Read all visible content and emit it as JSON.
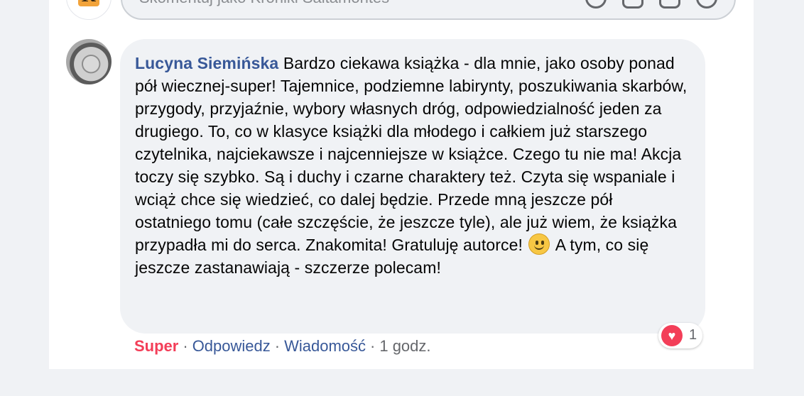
{
  "composer": {
    "placeholder": "Skomentuj jako Kroniki Saltamontes",
    "page_logo_letter": "K",
    "icons": [
      "emoji-icon",
      "camera-icon",
      "gif-icon",
      "sticker-icon"
    ]
  },
  "comment": {
    "author": "Lucyna Siemińska",
    "text_before_emoji": "Bardzo ciekawa książka - dla mnie, jako osoby ponad pół wiecznej-super! Tajemnice, podziemne labirynty, poszukiwania skarbów, przygody, przyjaźnie, wybory własnych dróg, odpowiedzialność jeden za drugiego. To, co w klasyce książki dla młodego i całkiem już starszego czytelnika, najciekawsze i najcenniejsze w książce. Czego tu nie ma! Akcja toczy się szybko. Są i duchy i czarne charaktery też. Czyta się wspaniale i wciąż chce się wiedzieć, co dalej będzie. Przede mną jeszcze pół ostatniego tomu (całe szczęście, że jeszcze tyle), ale już wiem, że książka przypadła mi do serca. Znakomita! Gratuluję autorce!",
    "emoji": "slightly-smiling-face-emoji",
    "text_after_emoji": "A tym, co się jeszcze zastanawiają - szczerze polecam!",
    "reaction": {
      "icon": "heart-icon",
      "count": "1"
    },
    "actions": {
      "reacted": "Super",
      "reply": "Odpowiedz",
      "message": "Wiadomość",
      "time": "1 godz."
    }
  },
  "colors": {
    "author": "#385898",
    "super": "#f33e58",
    "bubble": "#f0f2f5"
  }
}
